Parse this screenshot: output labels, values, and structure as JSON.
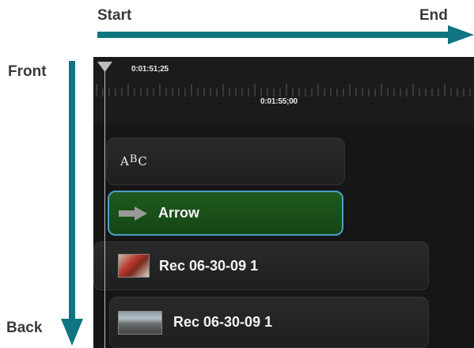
{
  "axis": {
    "start": "Start",
    "end": "End",
    "front": "Front",
    "back": "Back"
  },
  "ruler": {
    "current_time": "0:01:51;25",
    "marker_time": "0:01:55;00"
  },
  "tracks": [
    {
      "label": "ABC",
      "icon": "text-abc-icon",
      "style": "dark"
    },
    {
      "label": "Arrow",
      "icon": "arrow-right-icon",
      "style": "selected-green"
    },
    {
      "label": "Rec 06-30-09 1",
      "icon": "person-thumbnail",
      "style": "dark"
    },
    {
      "label": "Rec 06-30-09 1",
      "icon": "landscape-thumbnail",
      "style": "dark"
    }
  ],
  "colors": {
    "arrow": "#0f7581",
    "selected_clip": "#1f5a1f",
    "selected_border": "#4aa0c8",
    "timeline_bg": "#161616"
  }
}
